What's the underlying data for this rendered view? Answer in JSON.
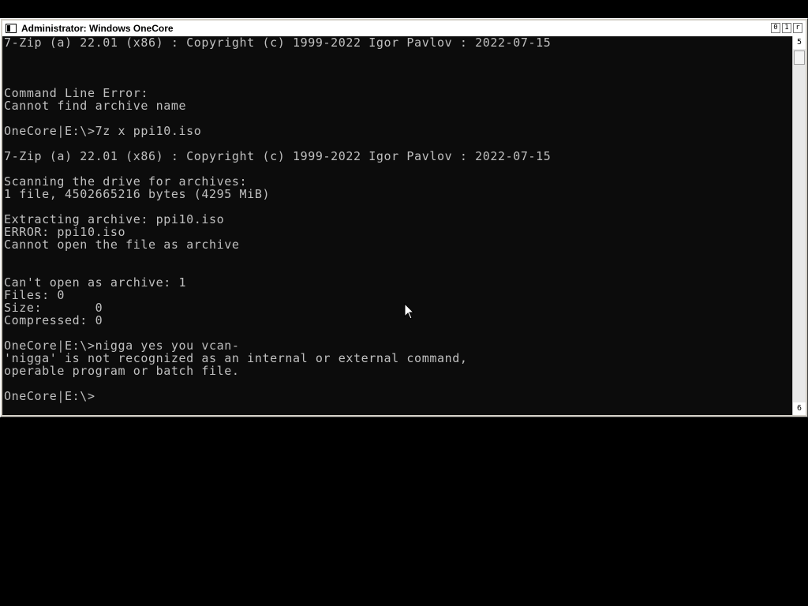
{
  "window": {
    "title": "Administrator:  Windows OneCore",
    "buttons": {
      "minimize": "0",
      "maximize": "1",
      "close": "r"
    }
  },
  "scrollbar": {
    "up_glyph": "5",
    "down_glyph": "6"
  },
  "console": {
    "lines": [
      "7-Zip (a) 22.01 (x86) : Copyright (c) 1999-2022 Igor Pavlov : 2022-07-15",
      "",
      "",
      "",
      "Command Line Error:",
      "Cannot find archive name",
      "",
      "OneCore|E:\\>7z x ppi10.iso",
      "",
      "7-Zip (a) 22.01 (x86) : Copyright (c) 1999-2022 Igor Pavlov : 2022-07-15",
      "",
      "Scanning the drive for archives:",
      "1 file, 4502665216 bytes (4295 MiB)",
      "",
      "Extracting archive: ppi10.iso",
      "ERROR: ppi10.iso",
      "Cannot open the file as archive",
      "",
      "",
      "Can't open as archive: 1",
      "Files: 0",
      "Size:       0",
      "Compressed: 0",
      "",
      "OneCore|E:\\>nigga yes you vcan-",
      "'nigga' is not recognized as an internal or external command,",
      "operable program or batch file.",
      "",
      "OneCore|E:\\>"
    ]
  },
  "colors": {
    "console_bg": "#0c0c0c",
    "console_text": "#c0c0c0",
    "desktop": "#000000"
  }
}
